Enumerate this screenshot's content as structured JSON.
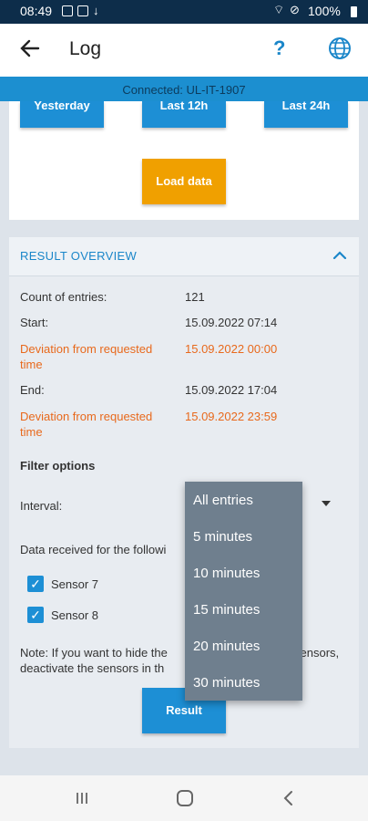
{
  "status_bar": {
    "time": "08:49",
    "battery": "100%"
  },
  "app_bar": {
    "title": "Log",
    "help_symbol": "?"
  },
  "connection": {
    "text": "Connected: UL-IT-1907"
  },
  "range_buttons": {
    "yesterday": "Yesterday",
    "last12": "Last 12h",
    "last24": "Last 24h",
    "load": "Load data"
  },
  "result_overview": {
    "title": "RESULT OVERVIEW",
    "count_label": "Count of entries:",
    "count_value": "121",
    "start_label": "Start:",
    "start_value": "15.09.2022 07:14",
    "dev1_label_l1": "Deviation from requested",
    "dev1_label_l2": "time",
    "dev1_value": "15.09.2022 00:00",
    "end_label": "End:",
    "end_value": "15.09.2022 17:04",
    "dev2_label_l1": "Deviation from requested",
    "dev2_label_l2": "time",
    "dev2_value": "15.09.2022 23:59"
  },
  "filter": {
    "title": "Filter options",
    "interval_label": "Interval:",
    "data_received_text": "Data received for the followi",
    "sensors": [
      {
        "label": "Sensor 7",
        "checked": true
      },
      {
        "label": "Sensor 8",
        "checked": true
      }
    ],
    "note_l1a": "Note: If you want to hide the",
    "note_l1b": "sensors,",
    "note_l2a": "deactivate the sensors in th",
    "result_button": "Result"
  },
  "interval_menu": {
    "options": [
      "All entries",
      "5 minutes",
      "10 minutes",
      "15 minutes",
      "20 minutes",
      "30 minutes"
    ]
  }
}
